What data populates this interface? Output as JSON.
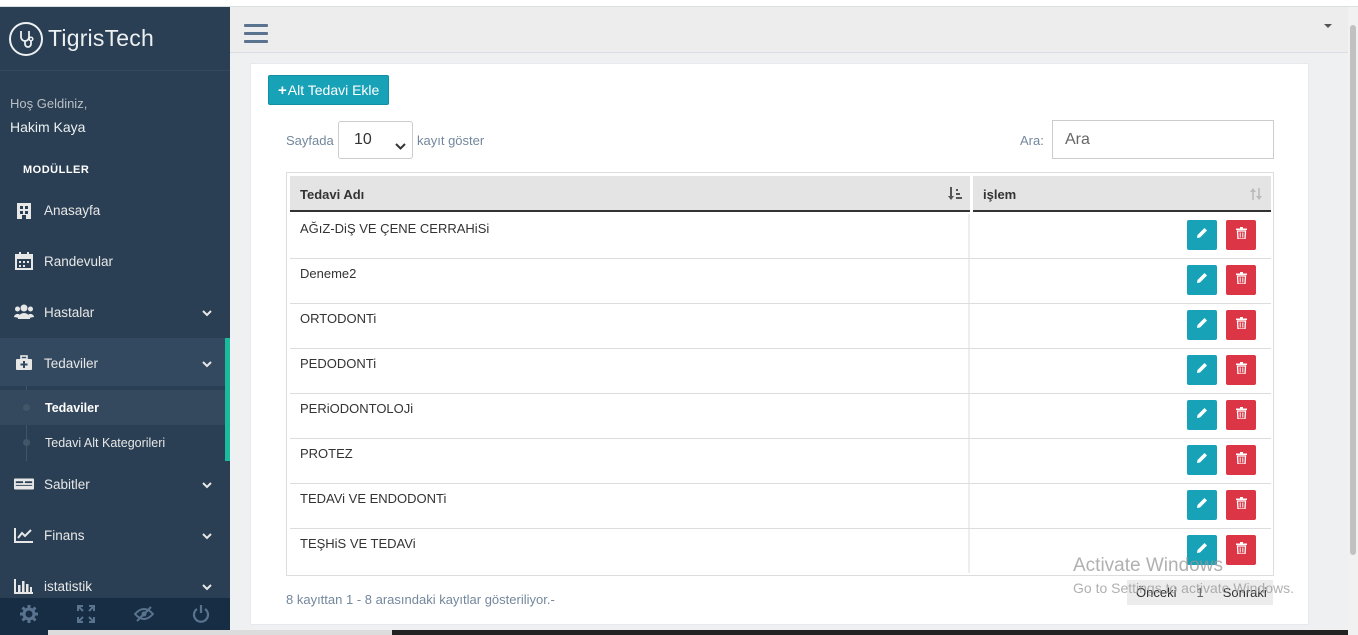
{
  "brand": {
    "title": "TigrisTech"
  },
  "sidebar": {
    "welcome": "Hoş Geldiniz,",
    "username": "Hakim Kaya",
    "modules_heading": "MODÜLLER",
    "items": [
      {
        "label": "Anasayfa",
        "icon": "hospital-icon",
        "has_children": false
      },
      {
        "label": "Randevular",
        "icon": "calendar-icon",
        "has_children": false
      },
      {
        "label": "Hastalar",
        "icon": "users-icon",
        "has_children": true
      },
      {
        "label": "Tedaviler",
        "icon": "medkit-icon",
        "has_children": true,
        "active": true
      },
      {
        "label": "Sabitler",
        "icon": "card-icon",
        "has_children": true
      },
      {
        "label": "Finans",
        "icon": "line-chart-icon",
        "has_children": true
      },
      {
        "label": "istatistik",
        "icon": "bar-chart-icon",
        "has_children": true
      }
    ],
    "submenu": [
      {
        "label": "Tedaviler",
        "current": true
      },
      {
        "label": "Tedavi Alt Kategorileri",
        "current": false
      }
    ],
    "footer_icons": [
      "settings-icon",
      "fullscreen-icon",
      "lock-icon",
      "power-icon"
    ]
  },
  "toolbar": {
    "add_label": "Alt Tedavi Ekle"
  },
  "length": {
    "prefix": "Sayfada",
    "value": "10",
    "suffix": "kayıt göster"
  },
  "search": {
    "label": "Ara:",
    "placeholder": "Ara"
  },
  "table": {
    "headers": [
      "Tedavi Adı",
      "işlem"
    ],
    "rows": [
      "AĞıZ-DiŞ VE ÇENE CERRAHiSi",
      "Deneme2",
      "ORTODONTi",
      "PEDODONTi",
      "PERiODONTOLOJi",
      "PROTEZ",
      "TEDAVi VE ENDODONTi",
      "TEŞHiS VE TEDAVi"
    ]
  },
  "info": "8 kayıttan 1 - 8 arasındaki kayıtlar gösteriliyor.-",
  "pagination": {
    "prev": "Önceki",
    "page": "1",
    "next": "Sonraki"
  },
  "watermark": {
    "line1": "Activate Windows",
    "line2": "Go to Settings to activate Windows."
  },
  "colors": {
    "sidebar": "#2a3f54",
    "accent": "#1abb9c",
    "info": "#17a2b8",
    "danger": "#dc3545"
  }
}
